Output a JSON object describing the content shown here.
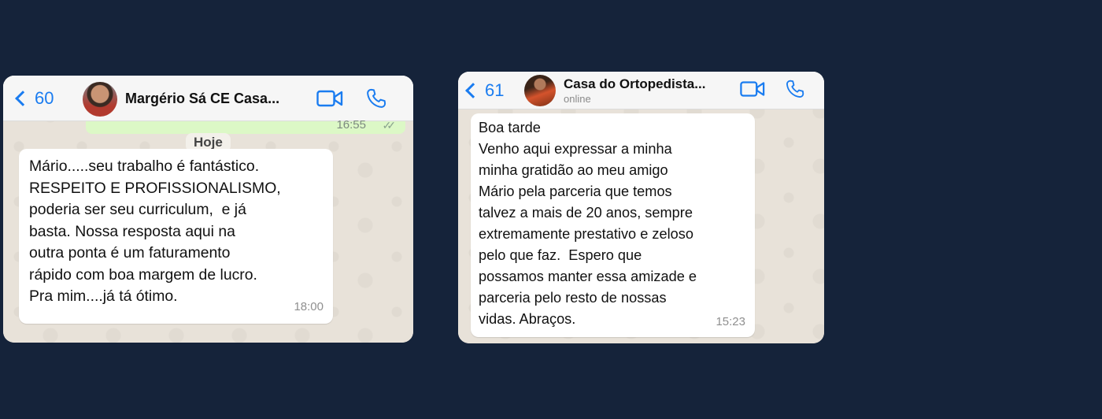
{
  "chats": [
    {
      "back_count": "60",
      "contact_name": "Margério Sá CE Casa...",
      "previous_message_time": "16:55",
      "day_label": "Hoje",
      "message": {
        "lines": [
          "Mário.....seu trabalho é fantástico.",
          "RESPEITO E PROFISSIONALISMO,",
          "poderia ser seu curriculum,  e já",
          "basta. Nossa resposta aqui na",
          "outra ponta é um faturamento",
          "rápido com boa margem de lucro.",
          "Pra mim....já tá ótimo."
        ],
        "time": "18:00"
      }
    },
    {
      "back_count": "61",
      "contact_name": "Casa do Ortopedista...",
      "status": "online",
      "message": {
        "lines": [
          "Boa tarde",
          "Venho aqui expressar a minha",
          "minha gratidão ao meu amigo",
          "Mário pela parceria que temos",
          "talvez a mais de 20 anos, sempre",
          "extremamente prestativo e zeloso",
          "pelo que faz.  Espero que",
          "possamos manter essa amizade e",
          "parceria pelo resto de nossas",
          "vidas. Abraços."
        ],
        "time": "15:23"
      }
    }
  ],
  "icons": {
    "back": "chevron-left-icon",
    "video": "video-camera-icon",
    "phone": "phone-icon"
  },
  "colors": {
    "page_background": "#15233a",
    "accent_blue": "#1a7cf0",
    "sent_bubble": "#dcf8c6",
    "received_bubble": "#ffffff"
  }
}
